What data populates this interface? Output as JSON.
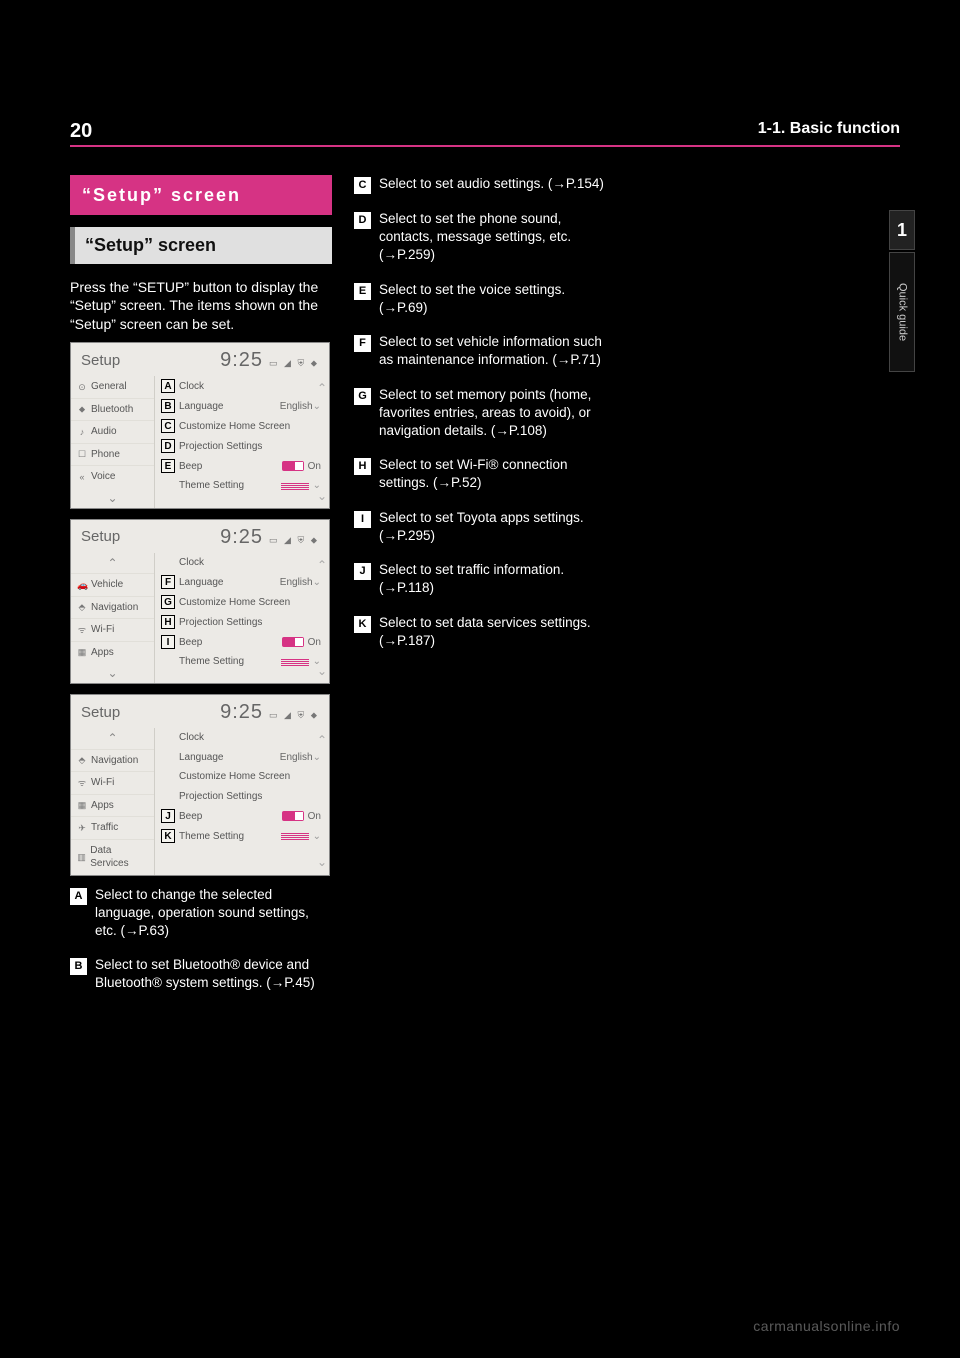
{
  "page": {
    "number": "20",
    "chapter": "1-1. Basic function",
    "side_index": "1",
    "side_label": "Quick guide"
  },
  "section": {
    "title_banner": "“Setup” screen",
    "heading": "“Setup” screen",
    "intro1": "Press the “SETUP” button to display the “Setup” screen. The items shown on the “Setup” screen can be set."
  },
  "screens": [
    {
      "title": "Setup",
      "time": "9:25",
      "status": "▭ ◢ ⛨ ⬥",
      "nav": [
        {
          "icon": "⊙",
          "label": "General",
          "first": true
        },
        {
          "icon": "⬥",
          "label": "Bluetooth"
        },
        {
          "icon": "♪",
          "label": "Audio"
        },
        {
          "icon": "☐",
          "label": "Phone"
        },
        {
          "icon": "«",
          "label": "Voice"
        }
      ],
      "nav_tail_arrow": "⌄",
      "rows": [
        {
          "marker": "A",
          "label": "Clock",
          "value": "",
          "extra": ""
        },
        {
          "marker": "B",
          "label": "Language",
          "value": "English",
          "extra": "chev"
        },
        {
          "marker": "C",
          "label": "Customize Home Screen",
          "value": "",
          "extra": ""
        },
        {
          "marker": "D",
          "label": "Projection Settings",
          "value": "",
          "extra": ""
        },
        {
          "marker": "E",
          "label": "Beep",
          "value": "On",
          "extra": "toggle"
        },
        {
          "marker": "",
          "label": "Theme Setting",
          "value": "",
          "extra": "theme"
        }
      ]
    },
    {
      "title": "Setup",
      "time": "9:25",
      "status": "▭ ◢ ⛨ ⬥",
      "nav": [
        {
          "icon": "⌃",
          "label": "",
          "first": true,
          "arrow": true
        },
        {
          "icon": "🚗",
          "label": "Vehicle"
        },
        {
          "icon": "⬘",
          "label": "Navigation"
        },
        {
          "icon": "ᯤ",
          "label": "Wi-Fi"
        },
        {
          "icon": "▦",
          "label": "Apps"
        }
      ],
      "nav_tail_arrow": "⌄",
      "rows": [
        {
          "marker": "",
          "label": "Clock",
          "value": "",
          "extra": ""
        },
        {
          "marker": "F",
          "label": "Language",
          "value": "English",
          "extra": "chev"
        },
        {
          "marker": "G",
          "label": "Customize Home Screen",
          "value": "",
          "extra": ""
        },
        {
          "marker": "H",
          "label": "Projection Settings",
          "value": "",
          "extra": ""
        },
        {
          "marker": "I",
          "label": "Beep",
          "value": "On",
          "extra": "toggle"
        },
        {
          "marker": "",
          "label": "Theme Setting",
          "value": "",
          "extra": "theme"
        }
      ]
    },
    {
      "title": "Setup",
      "time": "9:25",
      "status": "▭ ◢ ⛨ ⬥",
      "nav": [
        {
          "icon": "⌃",
          "label": "",
          "first": true,
          "arrow": true
        },
        {
          "icon": "⬘",
          "label": "Navigation"
        },
        {
          "icon": "ᯤ",
          "label": "Wi-Fi"
        },
        {
          "icon": "▦",
          "label": "Apps"
        },
        {
          "icon": "✈",
          "label": "Traffic"
        },
        {
          "icon": "▥",
          "label": "Data Services"
        }
      ],
      "nav_tail_arrow": "",
      "rows": [
        {
          "marker": "",
          "label": "Clock",
          "value": "",
          "extra": ""
        },
        {
          "marker": "",
          "label": "Language",
          "value": "English",
          "extra": "chev"
        },
        {
          "marker": "",
          "label": "Customize Home Screen",
          "value": "",
          "extra": ""
        },
        {
          "marker": "",
          "label": "Projection Settings",
          "value": "",
          "extra": ""
        },
        {
          "marker": "J",
          "label": "Beep",
          "value": "On",
          "extra": "toggle"
        },
        {
          "marker": "K",
          "label": "Theme Setting",
          "value": "",
          "extra": "theme"
        }
      ]
    }
  ],
  "leftItems": [
    {
      "marker": "A",
      "text": "Select to change the selected language, operation sound settings, etc. (→P.63)"
    },
    {
      "marker": "B",
      "text": "Select to set Bluetooth® device and Bluetooth® system settings. (→P.45)"
    }
  ],
  "rightItems": [
    {
      "marker": "C",
      "text": "Select to set audio settings. (→P.154)"
    },
    {
      "marker": "D",
      "text": "Select to set the phone sound, contacts, message settings, etc. (→P.259)"
    },
    {
      "marker": "E",
      "text": "Select to set the voice settings. (→P.69)"
    },
    {
      "marker": "F",
      "text": "Select to set vehicle information such as maintenance information. (→P.71)"
    },
    {
      "marker": "G",
      "text": "Select to set memory points (home, favorites entries, areas to avoid), or navigation details. (→P.108)"
    },
    {
      "marker": "H",
      "text": "Select to set Wi-Fi® connection settings. (→P.52)"
    },
    {
      "marker": "I",
      "text": "Select to set Toyota apps settings. (→P.295)"
    },
    {
      "marker": "J",
      "text": "Select to set traffic information. (→P.118)"
    },
    {
      "marker": "K",
      "text": "Select to set data services settings. (→P.187)"
    }
  ],
  "footer": "carmanualsonline.info"
}
